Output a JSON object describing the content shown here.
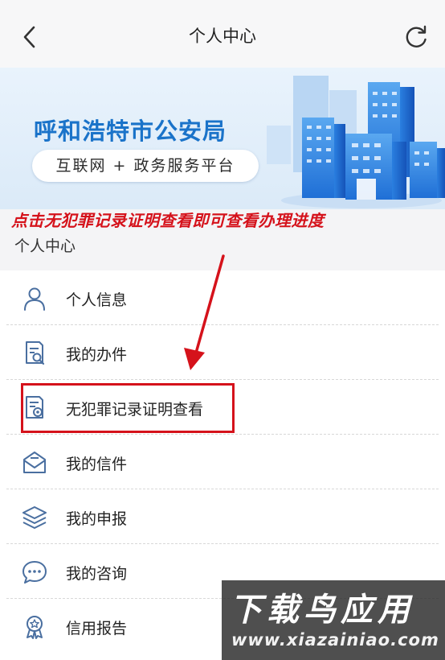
{
  "header": {
    "title": "个人中心",
    "back_icon": "chevron-left-icon",
    "refresh_icon": "refresh-icon"
  },
  "banner": {
    "org_name": "呼和浩特市公安局",
    "platform_name": "互联网 + 政务服务平台",
    "brand_color": "#1a73c9"
  },
  "annotation": {
    "text": "点击无犯罪记录证明查看即可查看办理进度",
    "color": "#d5121b"
  },
  "section": {
    "title": "个人中心"
  },
  "menu": {
    "items": [
      {
        "label": "个人信息",
        "icon": "user-icon"
      },
      {
        "label": "我的办件",
        "icon": "document-search-icon"
      },
      {
        "label": "无犯罪记录证明查看",
        "icon": "certificate-icon"
      },
      {
        "label": "我的信件",
        "icon": "envelope-icon"
      },
      {
        "label": "我的申报",
        "icon": "layers-icon"
      },
      {
        "label": "我的咨询",
        "icon": "chat-bubble-icon"
      },
      {
        "label": "信用报告",
        "icon": "award-icon"
      }
    ],
    "icon_color": "#4a6fa0"
  },
  "watermark": {
    "title": "下载鸟应用",
    "url": "www.xiazainiao.com"
  }
}
